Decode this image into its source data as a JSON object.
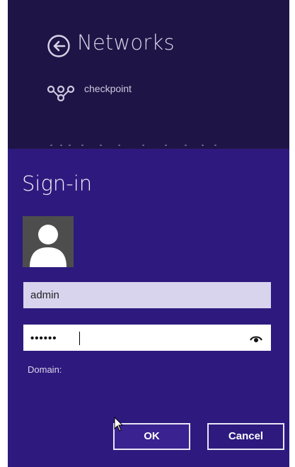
{
  "networks": {
    "title": "Networks",
    "network_name": "checkpoint"
  },
  "signin": {
    "title": "Sign-in",
    "username_value": "admin",
    "password_mask": "••••••",
    "domain_label": "Domain:",
    "ok_label": "OK",
    "cancel_label": "Cancel"
  },
  "colors": {
    "top_panel_bg": "#1f1446",
    "signin_panel_bg": "#2e1a7e",
    "username_field_bg": "#d9d4ee"
  },
  "icons": {
    "back": "back-arrow-circle-icon",
    "network": "network-link-icon",
    "avatar": "user-avatar-icon",
    "reveal": "reveal-password-eye-icon",
    "cursor": "mouse-pointer-icon"
  }
}
